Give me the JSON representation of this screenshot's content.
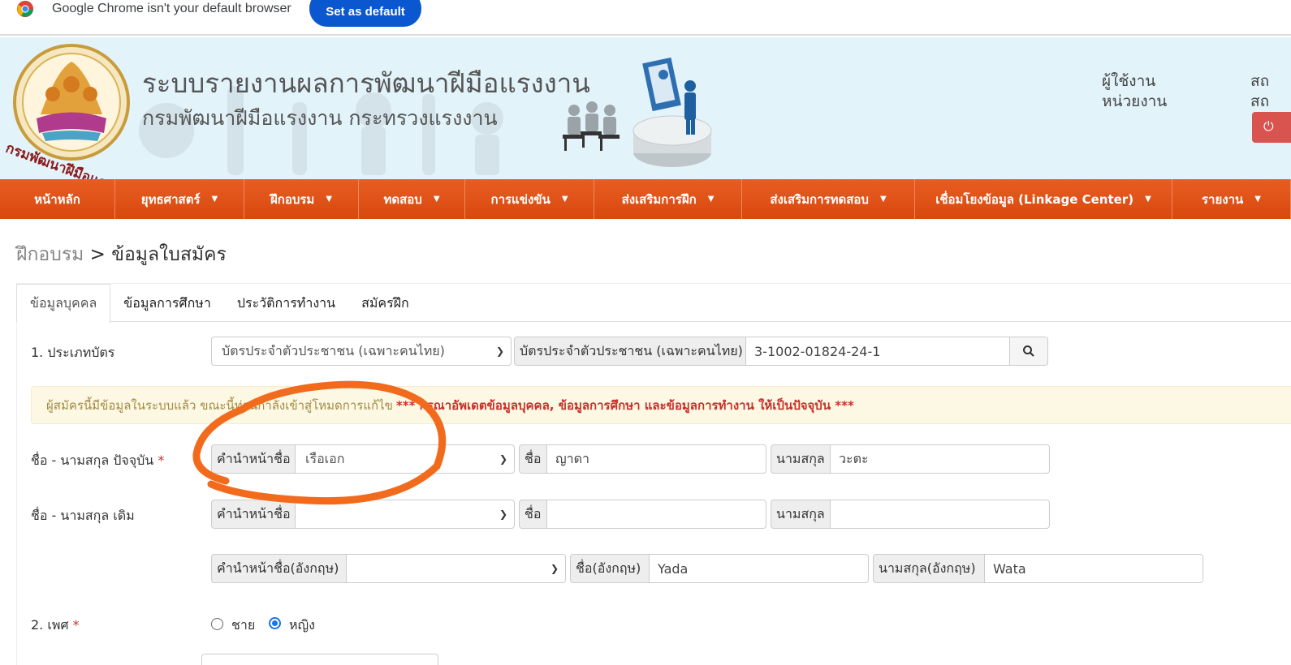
{
  "chrome": {
    "message": "Google Chrome isn't your default browser",
    "set_default": "Set as default"
  },
  "header": {
    "title": "ระบบรายงานผลการพัฒนาฝีมือแรงงาน",
    "subtitle": "กรมพัฒนาฝีมือแรงงาน กระทรวงแรงงาน",
    "user_label": "ผู้ใช้งาน",
    "unit_label": "หน่วยงาน",
    "user_value": "สถ",
    "unit_value": "สถ"
  },
  "nav": [
    {
      "label": "หน้าหลัก",
      "dropdown": false
    },
    {
      "label": "ยุทธศาสตร์",
      "dropdown": true
    },
    {
      "label": "ฝึกอบรม",
      "dropdown": true
    },
    {
      "label": "ทดสอบ",
      "dropdown": true
    },
    {
      "label": "การแข่งขัน",
      "dropdown": true
    },
    {
      "label": "ส่งเสริมการฝึก",
      "dropdown": true
    },
    {
      "label": "ส่งเสริมการทดสอบ",
      "dropdown": true
    },
    {
      "label": "เชื่อมโยงข้อมูล (Linkage Center)",
      "dropdown": true
    },
    {
      "label": "รายงาน",
      "dropdown": true
    }
  ],
  "breadcrumb": {
    "root": "ฝึกอบรม",
    "separator": " > ",
    "current": "ข้อมูลใบสมัคร"
  },
  "tabs": [
    {
      "label": "ข้อมูลบุคคล",
      "active": true
    },
    {
      "label": "ข้อมูลการศึกษา",
      "active": false
    },
    {
      "label": "ประวัติการทำงาน",
      "active": false
    },
    {
      "label": "สมัครฝึก",
      "active": false
    }
  ],
  "form": {
    "card_type": {
      "label": "1. ประเภทบัตร",
      "select_value": "บัตรประจำตัวประชาชน (เฉพาะคนไทย)",
      "addon": "บัตรประจำตัวประชาชน (เฉพาะคนไทย)",
      "id_value": "3-1002-01824-24-1"
    },
    "alert": {
      "notice": "ผู้สมัครนี้มีข้อมูลในระบบแล้ว ขณะนี้ท่านกำลังเข้าสู่โหมดการแก้ไข",
      "warning": "*** กรุณาอัพเดตข้อมูลบุคคล, ข้อมูลการศึกษา และข้อมูลการทำงาน ให้เป็นปัจจุบัน ***"
    },
    "current_name": {
      "label": "ชื่อ - นามสกุล ปัจจุบัน",
      "required": "*",
      "prefix_addon": "คำนำหน้าชื่อ",
      "prefix_value": "เรือเอก",
      "first_addon": "ชื่อ",
      "first_value": "ญาดา",
      "last_addon": "นามสกุล",
      "last_value": "วะตะ"
    },
    "former_name": {
      "label": "ชื่อ - นามสกุล เดิม",
      "prefix_addon": "คำนำหน้าชื่อ",
      "prefix_value": "",
      "first_addon": "ชื่อ",
      "first_value": "",
      "last_addon": "นามสกุล",
      "last_value": ""
    },
    "english_name": {
      "prefix_addon": "คำนำหน้าชื่อ(อังกฤษ)",
      "prefix_value": "",
      "first_addon": "ชื่อ(อังกฤษ)",
      "first_value": "Yada",
      "last_addon": "นามสกุล(อังกฤษ)",
      "last_value": "Wata"
    },
    "gender": {
      "label": "2. เพศ",
      "required": "*",
      "male": "ชาย",
      "female": "หญิง",
      "selected": "หญิง"
    }
  },
  "colors": {
    "nav": "#e2521a",
    "header_bg": "#e3f3fa",
    "annotation": "#f26b1d",
    "alert_text": "#a48a46",
    "alert_warning": "#c9302c"
  }
}
